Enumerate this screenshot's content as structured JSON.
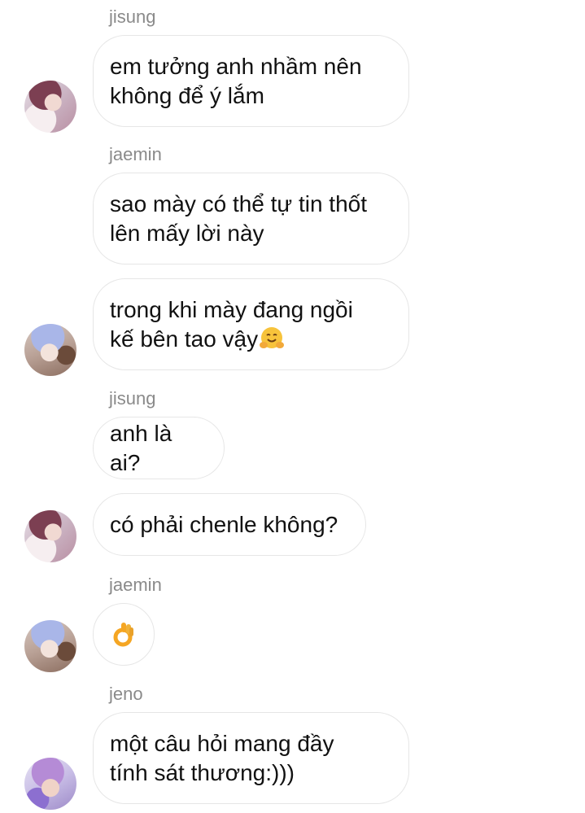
{
  "messages": [
    {
      "sender": "jisung",
      "text": "em tưởng anh nhầm nên\nkhông để ý lắm"
    },
    {
      "sender": "jaemin",
      "text": "sao mày có thể tự tin thốt\nlên mấy lời này"
    },
    {
      "sender": "",
      "text": "trong khi mày đang ngồi\nkế bên tao vậy"
    },
    {
      "sender": "jisung",
      "text": "anh là ai?"
    },
    {
      "sender": "",
      "text": "có phải chenle không?"
    },
    {
      "sender": "jaemin",
      "text": ""
    },
    {
      "sender": "jeno",
      "text": "một câu hỏi mang đầy\ntính sát thương:)))"
    }
  ],
  "emoji": {
    "hugging": "hugging-face-emoji",
    "ok_hand": "ok-hand-emoji"
  }
}
